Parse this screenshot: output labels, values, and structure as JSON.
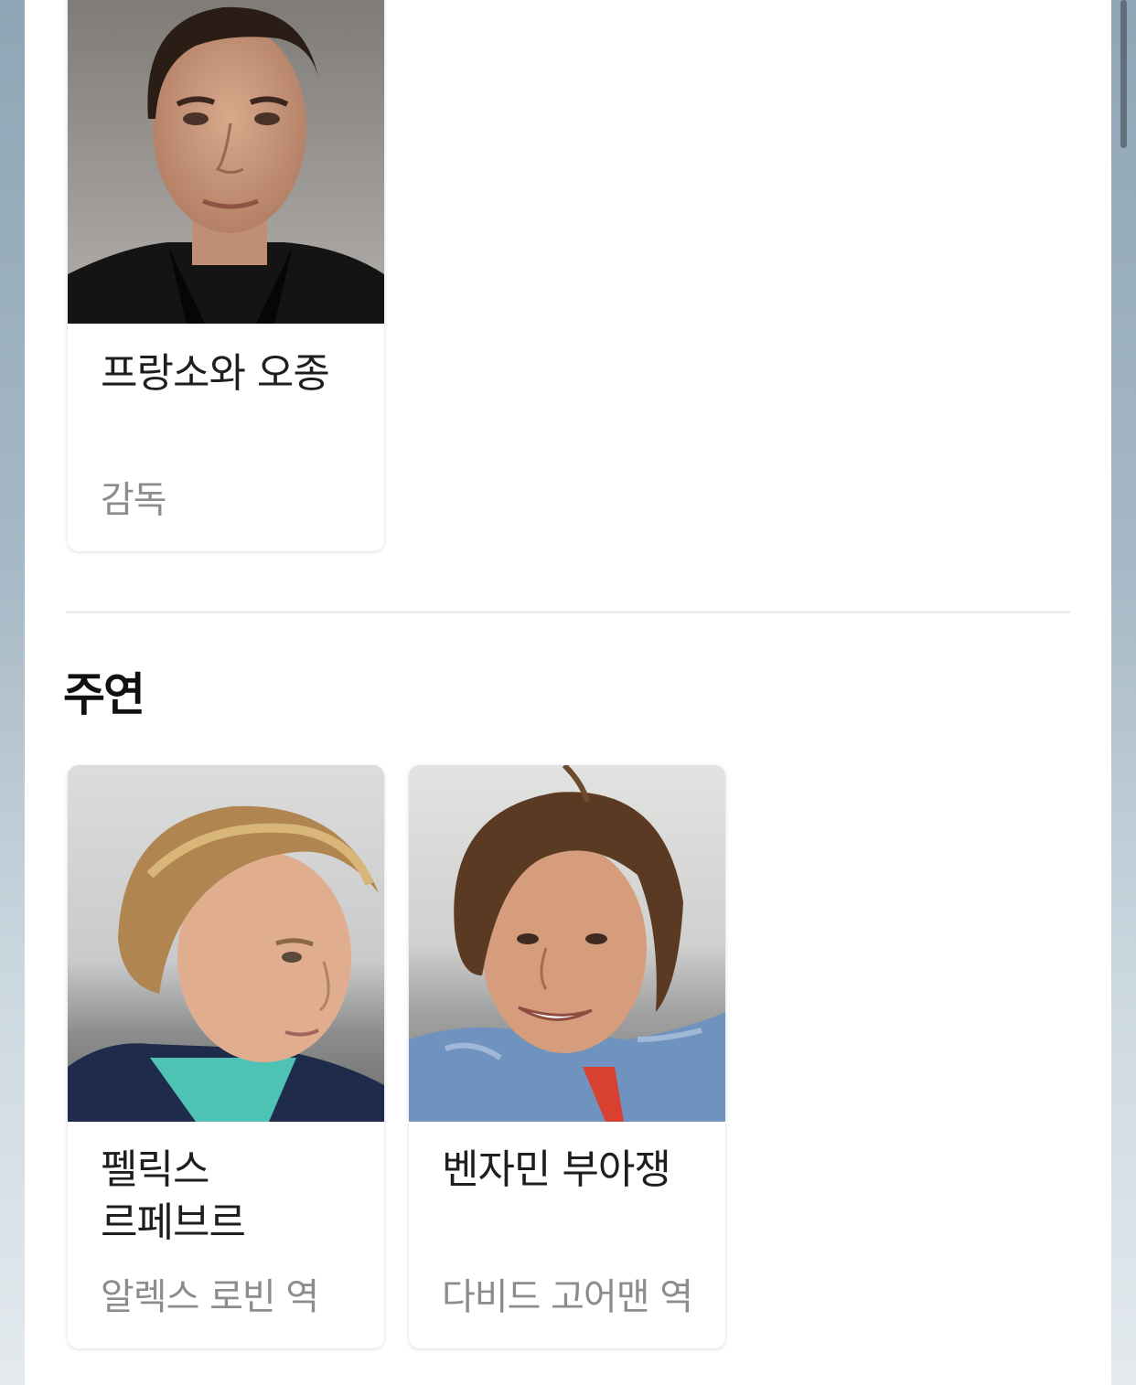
{
  "director": {
    "name": "프랑소와 오종",
    "role": "감독"
  },
  "cast_section": {
    "title": "주연",
    "members": [
      {
        "name": "펠릭스 르페브르",
        "role": "알렉스 로빈 역"
      },
      {
        "name": "벤자민 부아쟁",
        "role": "다비드 고어맨 역"
      }
    ]
  }
}
